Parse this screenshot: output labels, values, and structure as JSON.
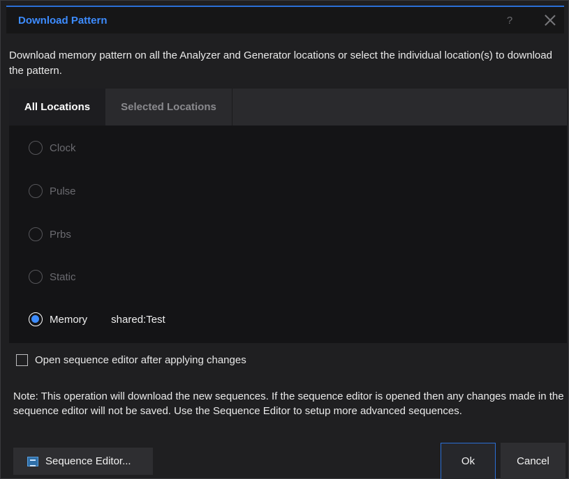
{
  "dialog": {
    "title": "Download Pattern",
    "help_label": "?",
    "description": "Download memory pattern on all the Analyzer and Generator locations or select the individual location(s) to download the pattern."
  },
  "tabs": [
    {
      "label": "All Locations",
      "active": true
    },
    {
      "label": "Selected Locations",
      "active": false
    }
  ],
  "patterns": [
    {
      "label": "Clock",
      "checked": false,
      "enabled": false
    },
    {
      "label": "Pulse",
      "checked": false,
      "enabled": false
    },
    {
      "label": "Prbs",
      "checked": false,
      "enabled": false
    },
    {
      "label": "Static",
      "checked": false,
      "enabled": false
    },
    {
      "label": "Memory",
      "checked": true,
      "enabled": true,
      "value": "shared:Test"
    }
  ],
  "options": {
    "open_editor_label": "Open sequence editor after applying changes",
    "open_editor_checked": false
  },
  "note": "Note: This operation will download the new sequences. If the sequence editor is opened then any changes made in the sequence editor will not be saved. Use the Sequence Editor to setup more advanced sequences.",
  "buttons": {
    "sequence_editor": "Sequence Editor...",
    "ok": "Ok",
    "cancel": "Cancel"
  },
  "colors": {
    "accent": "#3d8cff",
    "background": "#1f1f21"
  }
}
